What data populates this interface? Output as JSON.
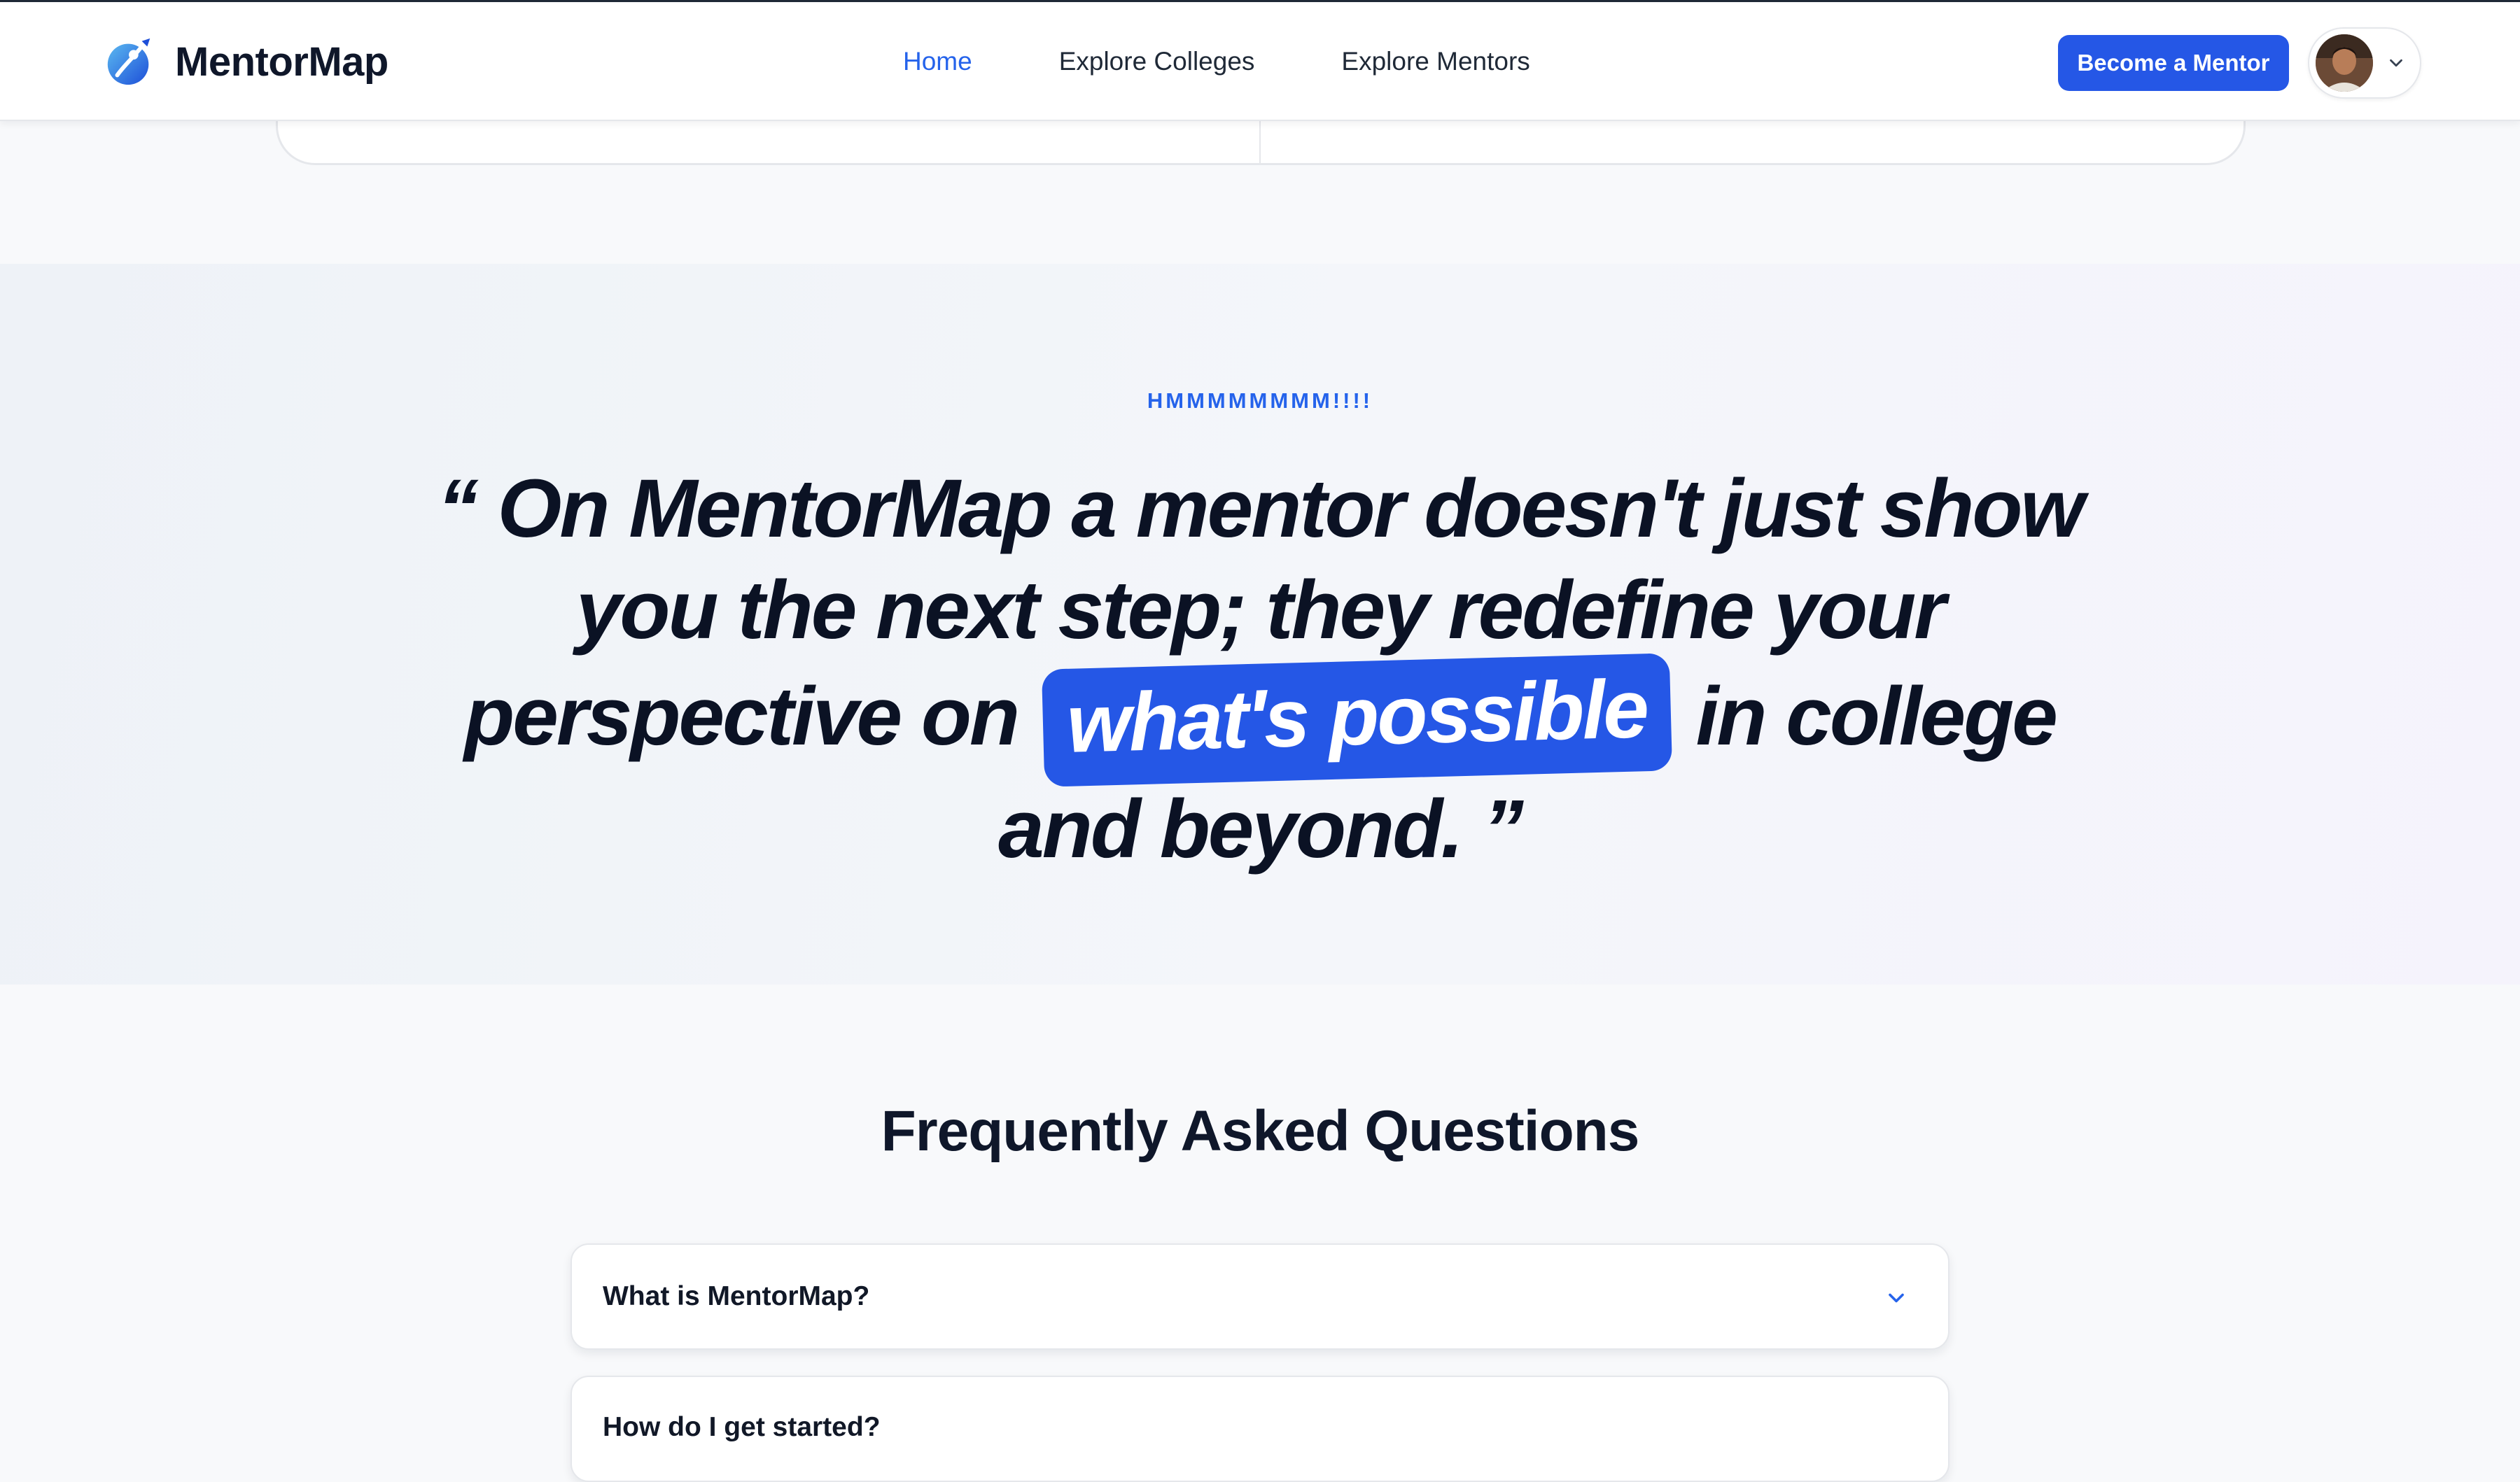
{
  "header": {
    "logo_text": "MentorMap",
    "nav": [
      {
        "label": "Home",
        "active": true
      },
      {
        "label": "Explore Colleges",
        "active": false
      },
      {
        "label": "Explore Mentors",
        "active": false
      }
    ],
    "cta_label": "Become a Mentor",
    "profile_icon": "chevron-down-icon"
  },
  "quote_section": {
    "kicker": "HMMMMMMMM!!!!",
    "quote_before": "“ On MentorMap a mentor doesn't just show you the next step; they redefine your perspective on",
    "quote_highlight": "what's possible",
    "quote_after": "in college and beyond. ”"
  },
  "faq": {
    "title": "Frequently Asked Questions",
    "items": [
      {
        "question": "What is MentorMap?"
      },
      {
        "question": "How do I get started?"
      }
    ]
  },
  "colors": {
    "accent": "#2557e6",
    "link_active": "#2563eb",
    "text_dark": "#0f172a"
  }
}
